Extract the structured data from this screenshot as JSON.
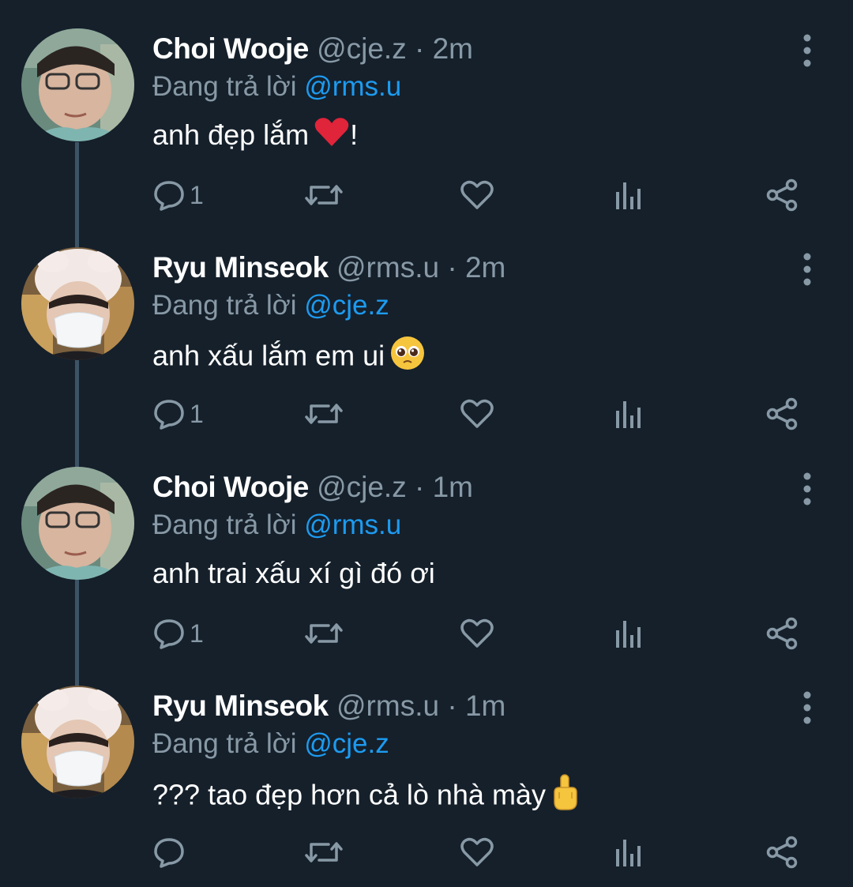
{
  "reply_prefix": "Đang trả lời",
  "tweets": [
    {
      "name": "Choi Wooje",
      "handle": "@cje.z",
      "separator": "·",
      "time": "2m",
      "reply_to": "@rms.u",
      "text": "anh đẹp lắm",
      "text_suffix": "!",
      "emoji": "red-heart",
      "reply_count": "1",
      "avatar": "choi"
    },
    {
      "name": "Ryu Minseok",
      "handle": "@rms.u",
      "separator": "·",
      "time": "2m",
      "reply_to": "@cje.z",
      "text": "anh xấu lắm em ui",
      "text_suffix": "",
      "emoji": "pleading-face",
      "reply_count": "1",
      "avatar": "ryu"
    },
    {
      "name": "Choi Wooje",
      "handle": "@cje.z",
      "separator": "·",
      "time": "1m",
      "reply_to": "@rms.u",
      "text": "anh trai xấu xí gì đó ơi",
      "text_suffix": "",
      "emoji": "",
      "reply_count": "1",
      "avatar": "choi"
    },
    {
      "name": "Ryu Minseok",
      "handle": "@rms.u",
      "separator": "·",
      "time": "1m",
      "reply_to": "@cje.z",
      "text": "??? tao đẹp hơn cả lò nhà mày",
      "text_suffix": "",
      "emoji": "middle-finger",
      "reply_count": "",
      "avatar": "ryu"
    }
  ],
  "colors": {
    "background": "#15202b",
    "secondary_text": "#8899a6",
    "mention": "#1d9bf0",
    "thread_line": "#3d5466"
  }
}
